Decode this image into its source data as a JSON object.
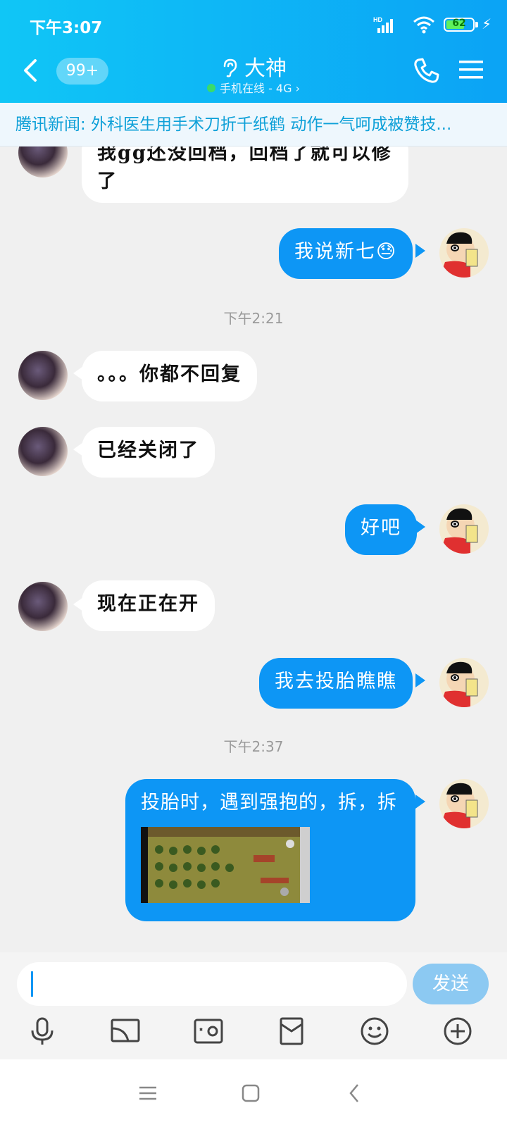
{
  "status_bar": {
    "time": "下午3:07",
    "battery": "62",
    "network_label": "HD"
  },
  "header": {
    "unread_badge": "99+",
    "title": "大神",
    "subtitle": "手机在线 - 4G ›"
  },
  "news_ticker": "腾讯新闻: 外科医生用手术刀折千纸鹤 动作一气呵成被赞技...",
  "messages": [
    {
      "side": "left",
      "text": "我gg还没回档，回档了就可以修了",
      "partial": true
    },
    {
      "side": "right",
      "text": "我说新七",
      "emoji": "😓"
    },
    {
      "timestamp": "下午2:21"
    },
    {
      "side": "left",
      "text": "。。。你都不回复"
    },
    {
      "side": "left",
      "text": "已经关闭了"
    },
    {
      "side": "right",
      "text": "好吧"
    },
    {
      "side": "left",
      "text": "现在正在开"
    },
    {
      "side": "right",
      "text": "我去投胎瞧瞧"
    },
    {
      "timestamp": "下午2:37"
    },
    {
      "side": "right",
      "text": "投胎时，遇到强抱的，拆，拆",
      "has_image": true
    }
  ],
  "input": {
    "value": "",
    "send_label": "发送"
  },
  "toolbar_icons": [
    "mic-icon",
    "screen-cast-icon",
    "photo-icon",
    "red-packet-icon",
    "emoji-icon",
    "plus-icon"
  ],
  "nav_icons": [
    "recent-apps-icon",
    "home-icon",
    "back-icon"
  ],
  "colors": {
    "header": "#0ba3f5",
    "bubble_right": "#0d96f5",
    "send_button": "#8cc9f2"
  }
}
